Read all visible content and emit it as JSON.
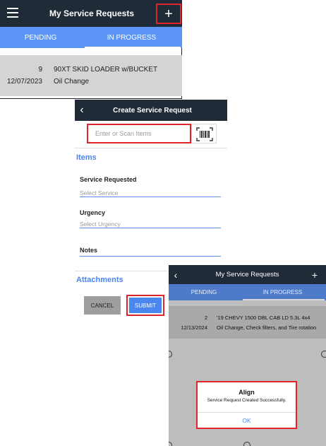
{
  "screen1": {
    "title": "My Service Requests",
    "tabs": [
      {
        "label": "PENDING"
      },
      {
        "label": "IN PROGRESS"
      }
    ],
    "row": {
      "id": "9",
      "name": "90XT SKID LOADER w/BUCKET",
      "date": "12/07/2023",
      "service": "Oil Change"
    }
  },
  "screen2": {
    "title": "Create Service Request",
    "search_placeholder": "Enter or Scan Items",
    "items_heading": "Items",
    "service_label": "Service Requested",
    "service_placeholder": "Select Service",
    "urgency_label": "Urgency",
    "urgency_placeholder": "Select Urgency",
    "notes_label": "Notes",
    "attachments_heading": "Attachments",
    "cancel_label": "CANCEL",
    "submit_label": "SUBMIT"
  },
  "screen3": {
    "title": "My Service Requests",
    "tabs": [
      {
        "label": "PENDING"
      },
      {
        "label": "IN PROGRESS"
      }
    ],
    "row": {
      "id": "2",
      "name": "'19 CHEVY 1500 DBL CAB LD 5.3L 4x4",
      "date": "12/13/2024",
      "service": "Oil Change, Check filters, and Tire rotation"
    },
    "dialog": {
      "title": "Align",
      "message": "Service Request Created Successfully.",
      "ok_label": "OK"
    }
  },
  "colors": {
    "header": "#1f2b36",
    "tab_bar": "#5b95f5",
    "highlight": "#e0242c",
    "accent": "#4a86f0"
  }
}
